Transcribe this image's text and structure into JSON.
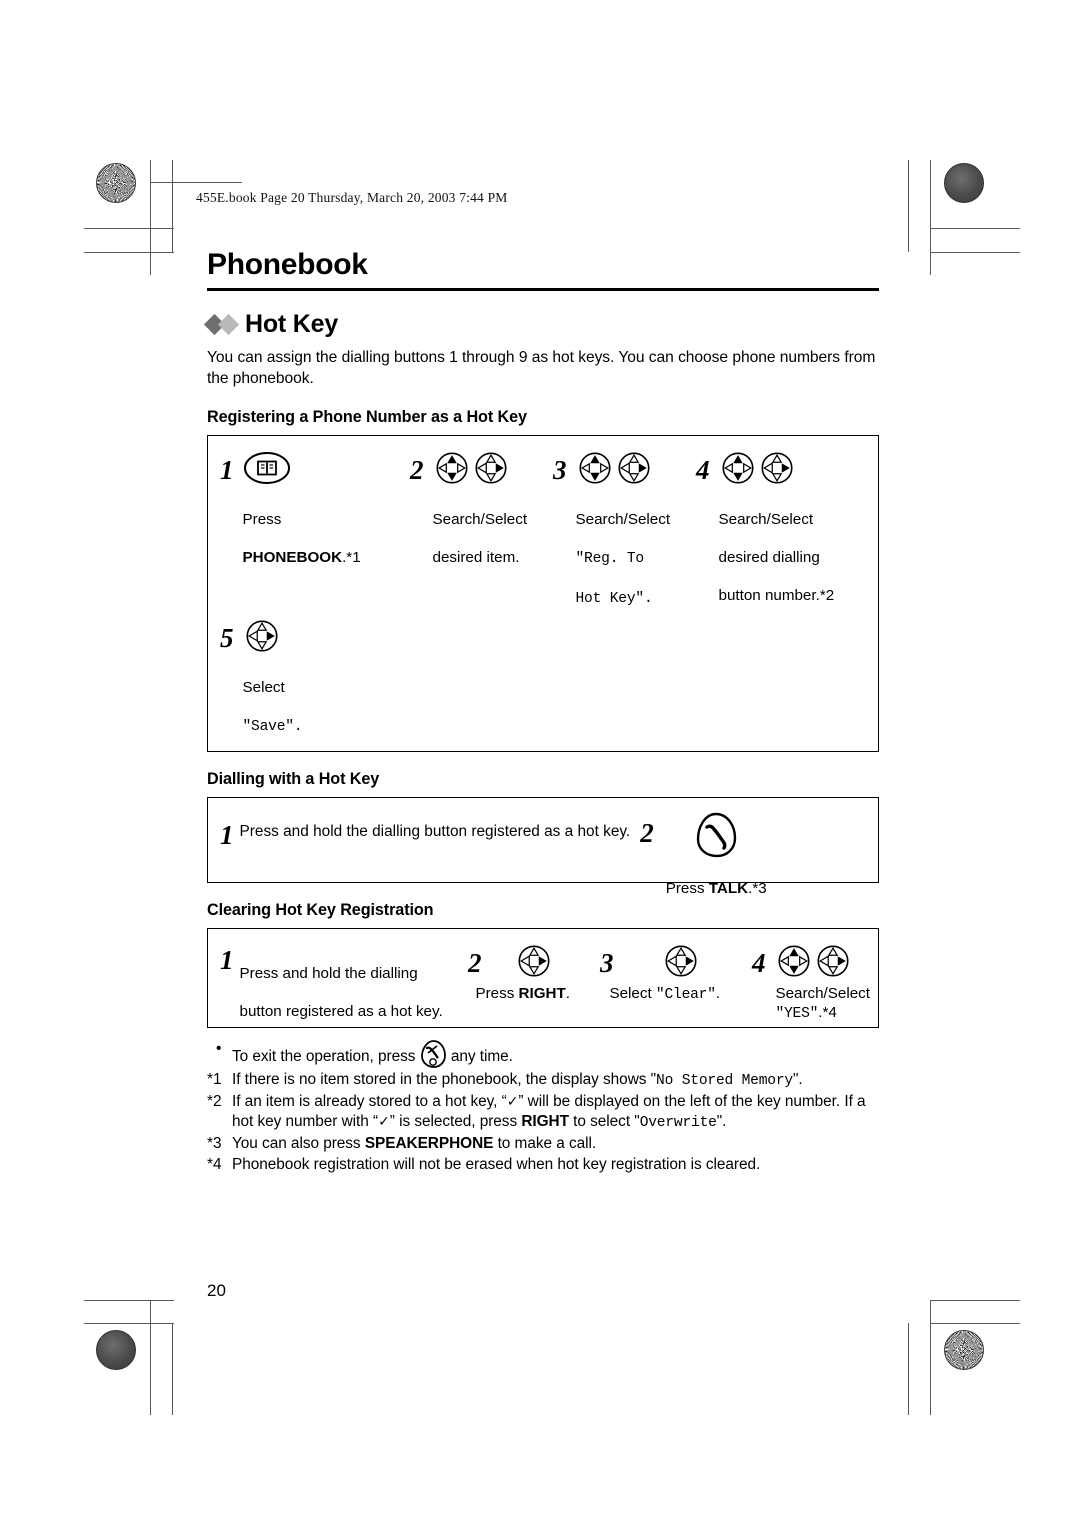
{
  "page": {
    "file_header": "455E.book  Page 20  Thursday, March 20, 2003  7:44 PM",
    "folio": "20",
    "chapter_title": "Phonebook"
  },
  "section": {
    "title": "Hot Key",
    "intro": "You can assign the dialling buttons 1 through 9 as hot keys. You can choose phone numbers from the phonebook."
  },
  "procedures": [
    {
      "heading": "Registering a Phone Number as a Hot Key",
      "steps": [
        {
          "num": "1",
          "icons": [
            "phonebook-icon"
          ],
          "line1": "Press",
          "line2_bold": "PHONEBOOK",
          "line2_tail": ".*1"
        },
        {
          "num": "2",
          "icons": [
            "search-dpad-icon",
            "select-dpad-icon"
          ],
          "line1": "Search/Select",
          "line2": "desired item."
        },
        {
          "num": "3",
          "icons": [
            "search-dpad-icon",
            "select-dpad-icon"
          ],
          "line1": "Search/Select",
          "mono1": "\"Reg. To",
          "mono2": "Hot Key\"."
        },
        {
          "num": "4",
          "icons": [
            "search-dpad-icon",
            "select-dpad-icon"
          ],
          "line1": "Search/Select",
          "line2": "desired dialling",
          "line3": "button  number.*2"
        },
        {
          "num": "5",
          "icons": [
            "select-dpad-icon"
          ],
          "line1": "Select",
          "mono1": "\"Save\"."
        }
      ]
    },
    {
      "heading": "Dialling with a Hot Key",
      "steps": [
        {
          "num": "1",
          "icons": [],
          "line1": "Press and hold the dialling button registered as a hot key."
        },
        {
          "num": "2",
          "icons": [
            "talk-icon"
          ],
          "line1_pre": "Press ",
          "line1_bold": "TALK",
          "line1_post": ".*3"
        }
      ]
    },
    {
      "heading": "Clearing Hot Key Registration",
      "steps": [
        {
          "num": "1",
          "icons": [],
          "line1": "Press and hold the dialling",
          "line2": "button registered as a hot key."
        },
        {
          "num": "2",
          "icons": [
            "select-dpad-icon"
          ],
          "line1_pre": "Press ",
          "line1_bold": "RIGHT",
          "line1_post": "."
        },
        {
          "num": "3",
          "icons": [
            "select-dpad-icon"
          ],
          "line1_pre": "Select ",
          "line1_mono": "\"Clear\"",
          "line1_post": "."
        },
        {
          "num": "4",
          "icons": [
            "search-dpad-icon",
            "select-dpad-icon"
          ],
          "line1": "Search/Select",
          "mono1": "\"YES\"",
          "mono1_tail": ".*4"
        }
      ]
    }
  ],
  "notes": [
    {
      "marker": "•",
      "pre": "To exit the operation, press ",
      "icon": "off-icon",
      "post": " any time."
    },
    {
      "marker": "*1",
      "pre": "If there is no item stored in the phonebook, the display shows \"",
      "mono": "No Stored Memory",
      "post": "\"."
    },
    {
      "marker": "*2",
      "pre": "If an item is already stored to a hot key, “",
      "check": "✓",
      "mid": "” will be displayed on the left of the key number. If a hot key number with “",
      "check2": "✓",
      "mid2": "” is selected, press ",
      "bold": "RIGHT",
      "mid3": " to select \"",
      "mono": "Overwrite",
      "post": "\"."
    },
    {
      "marker": "*3",
      "pre": "You can also press ",
      "bold": "SPEAKERPHONE",
      "post": " to make a call."
    },
    {
      "marker": "*4",
      "pre": "Phonebook registration will not be erased when hot key registration is cleared."
    }
  ]
}
